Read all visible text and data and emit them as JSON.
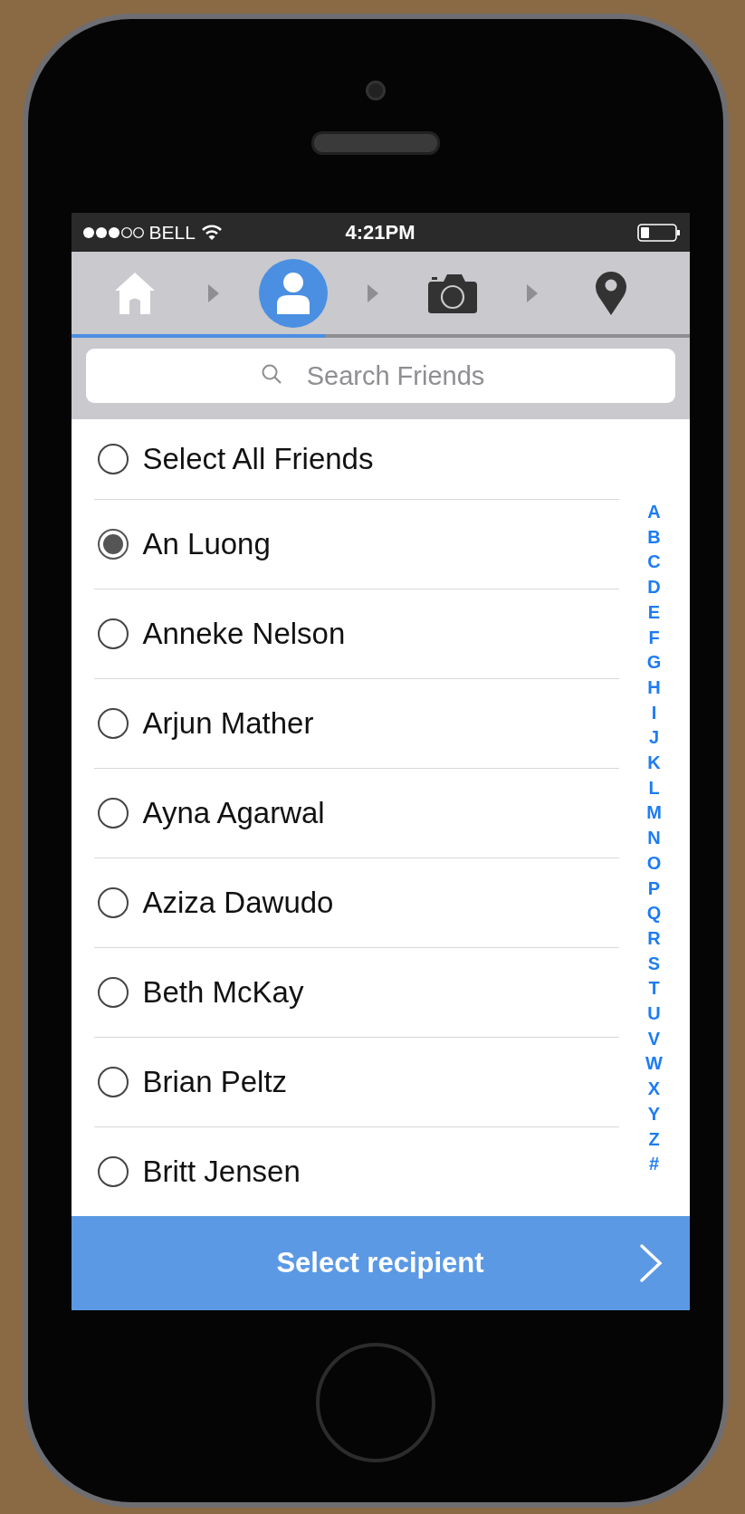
{
  "status_bar": {
    "carrier": "BELL",
    "time": "4:21PM"
  },
  "steps": [
    {
      "kind": "home",
      "selected": false,
      "completed": true
    },
    {
      "kind": "person",
      "selected": true,
      "completed": false
    },
    {
      "kind": "camera",
      "selected": false,
      "completed": false
    },
    {
      "kind": "pin",
      "selected": false,
      "completed": false
    }
  ],
  "progress": {
    "level": 0.41
  },
  "search": {
    "placeholder": "Search Friends"
  },
  "friends": [
    {
      "name": "Select All Friends",
      "selected": false
    },
    {
      "name": "An Luong",
      "selected": true
    },
    {
      "name": "Anneke Nelson",
      "selected": false
    },
    {
      "name": "Arjun Mather",
      "selected": false
    },
    {
      "name": "Ayna Agarwal",
      "selected": false
    },
    {
      "name": "Aziza Dawudo",
      "selected": false
    },
    {
      "name": "Beth McKay",
      "selected": false
    },
    {
      "name": "Brian Peltz",
      "selected": false
    },
    {
      "name": "Britt Jensen",
      "selected": false
    }
  ],
  "index_letters": [
    "A",
    "B",
    "C",
    "D",
    "E",
    "F",
    "G",
    "H",
    "I",
    "J",
    "K",
    "L",
    "M",
    "N",
    "O",
    "P",
    "Q",
    "R",
    "S",
    "T",
    "U",
    "V",
    "W",
    "X",
    "Y",
    "Z",
    "#"
  ],
  "action_button": {
    "label": "Select recipient"
  }
}
